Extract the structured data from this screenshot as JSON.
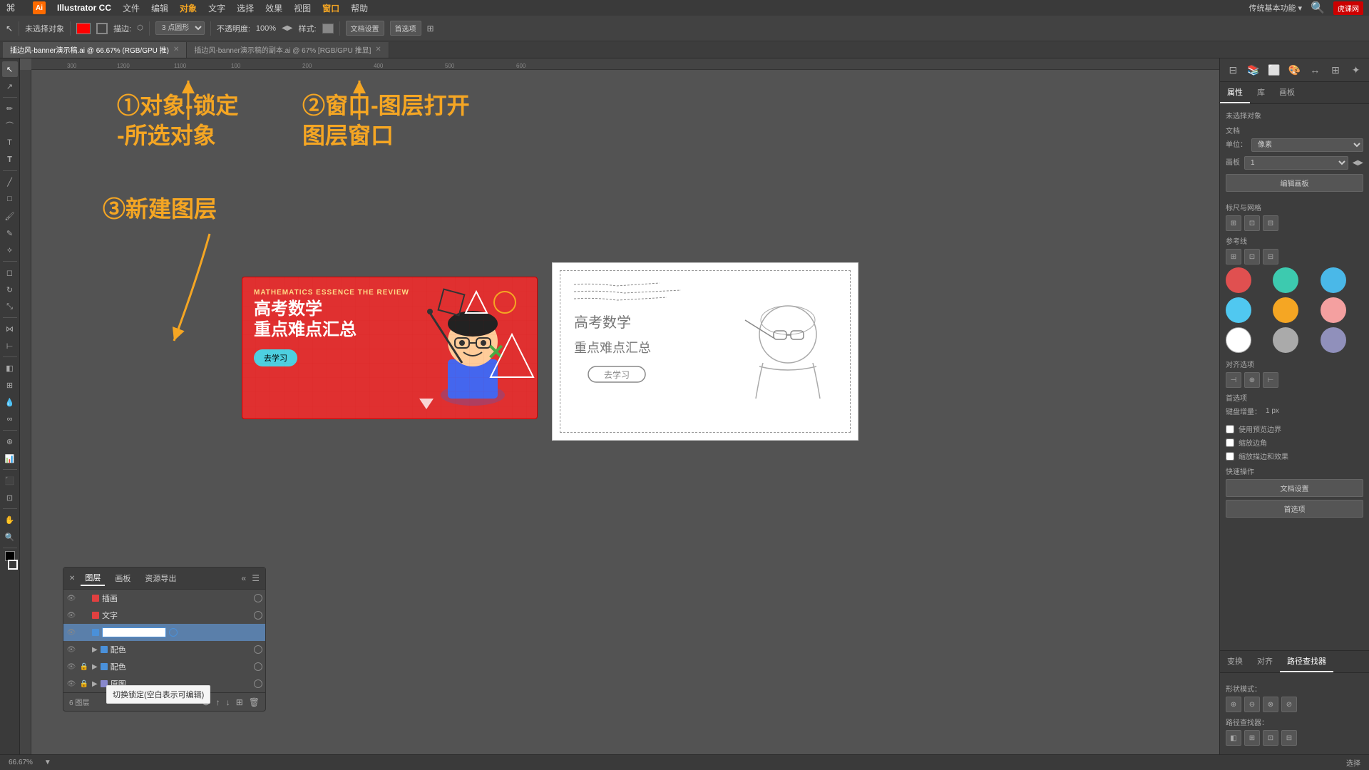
{
  "app": {
    "name": "Illustrator CC",
    "title": "Illustrator CC"
  },
  "menu": {
    "apple": "⌘",
    "items": [
      "文件",
      "编辑",
      "对象",
      "文字",
      "选择",
      "效果",
      "视图",
      "窗口",
      "帮助"
    ]
  },
  "toolbar": {
    "no_selection": "未选择对象",
    "stroke_label": "描边:",
    "shape_option": "3 点圆形",
    "opacity_label": "不透明度:",
    "opacity_value": "100%",
    "style_label": "样式:",
    "doc_settings": "文档设置",
    "preferences": "首选项"
  },
  "tabs": [
    {
      "label": "插边风-banner演示稿.ai",
      "zoom": "66.67%",
      "mode": "RGB/GPU",
      "active": true
    },
    {
      "label": "插边风-banner演示稿的副本.ai",
      "zoom": "67%",
      "mode": "RGB/GPU 推显",
      "active": false
    }
  ],
  "annotations": {
    "step1": "①对象-锁定\n-所选对象",
    "step2": "②窗口-图层打开\n图层窗口",
    "step3": "③新建图层"
  },
  "canvas": {
    "zoom": "66.67%",
    "zoom_label": "66.67%"
  },
  "layer_panel": {
    "tabs": [
      "图层",
      "画板",
      "资源导出"
    ],
    "layers": [
      {
        "name": "插画",
        "visible": true,
        "locked": false,
        "color": "#e04040",
        "hasGroup": false
      },
      {
        "name": "文字",
        "visible": true,
        "locked": false,
        "color": "#e04040",
        "hasGroup": false
      },
      {
        "name": "",
        "visible": true,
        "locked": false,
        "color": "#4a90d9",
        "editing": true,
        "hasGroup": false
      },
      {
        "name": "配色",
        "visible": true,
        "locked": false,
        "color": "#4a90d9",
        "hasGroup": true,
        "expanded": false
      },
      {
        "name": "配色",
        "visible": true,
        "locked": true,
        "color": "#4a90d9",
        "hasGroup": true,
        "expanded": false
      },
      {
        "name": "原图",
        "visible": true,
        "locked": true,
        "color": "#8888cc",
        "hasGroup": true,
        "expanded": false
      }
    ],
    "count": "6 图层",
    "tooltip": "切换锁定(空白表示可编辑)"
  },
  "right_panel": {
    "tabs": [
      "属性",
      "库",
      "画板"
    ],
    "section_title": "未选择对象",
    "doc_section": "文档",
    "unit_label": "单位：",
    "unit_value": "像素",
    "artboard_label": "画板",
    "artboard_value": "1",
    "edit_artboard_btn": "编辑画板",
    "snap_section": "标尺与网格",
    "guides_section": "参考线",
    "align_section": "对齐选项",
    "prefs_section": "首选项",
    "nudge_label": "键盘增量：",
    "nudge_value": "1 px",
    "use_preview_label": "使用预览边界",
    "corner_label": "缩放边角",
    "scale_strokes_label": "缩放描边和效果",
    "quick_actions": "快速操作",
    "doc_settings_btn": "文档设置",
    "preferences_btn": "首选项",
    "bottom_tabs": [
      "变换",
      "对齐",
      "路径查找器"
    ],
    "shape_mode_label": "形状模式：",
    "path_finder_label": "路径查找器："
  },
  "colors": {
    "swatches": [
      "#e05050",
      "#3dcaaf",
      "#4ab8e8",
      "#50c8f0",
      "#f5a623",
      "#f4a0a0",
      "#ffffff",
      "#aaaaaa",
      "#9090bb"
    ],
    "accent": "#f5a623",
    "bg": "#535353"
  },
  "status_bar": {
    "zoom": "66.67%",
    "mode_label": "选择"
  },
  "banner": {
    "subtitle": "MATHEMATICS ESSENCE THE REVIEW",
    "title_line1": "高考数学",
    "title_line2": "重点难点汇总",
    "btn_label": "去学习"
  }
}
